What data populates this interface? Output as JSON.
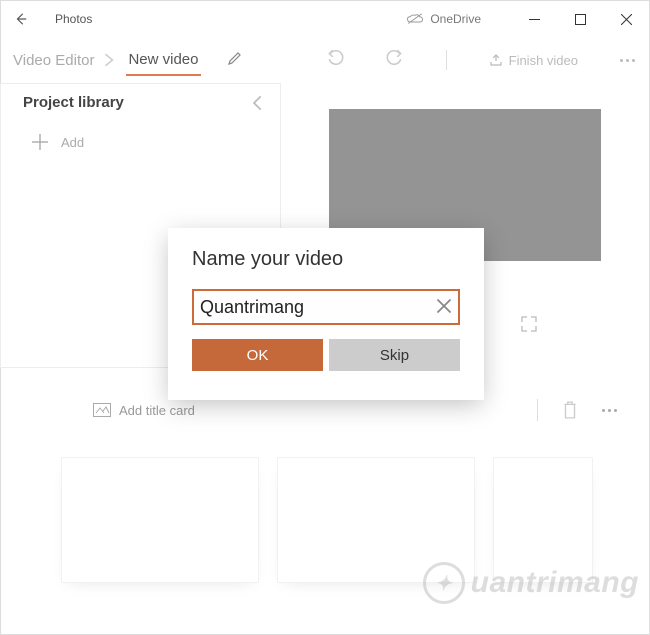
{
  "titlebar": {
    "app_name": "Photos",
    "onedrive_label": "OneDrive"
  },
  "toolbar": {
    "crumb_root": "Video Editor",
    "crumb_current": "New video",
    "finish_label": "Finish video"
  },
  "sidebar": {
    "title": "Project library",
    "add_label": "Add"
  },
  "strip": {
    "add_title_card": "Add title card"
  },
  "dialog": {
    "title": "Name your video",
    "input_value": "Quantrimang",
    "ok_label": "OK",
    "skip_label": "Skip"
  },
  "watermark": {
    "text": "uantrimang"
  }
}
